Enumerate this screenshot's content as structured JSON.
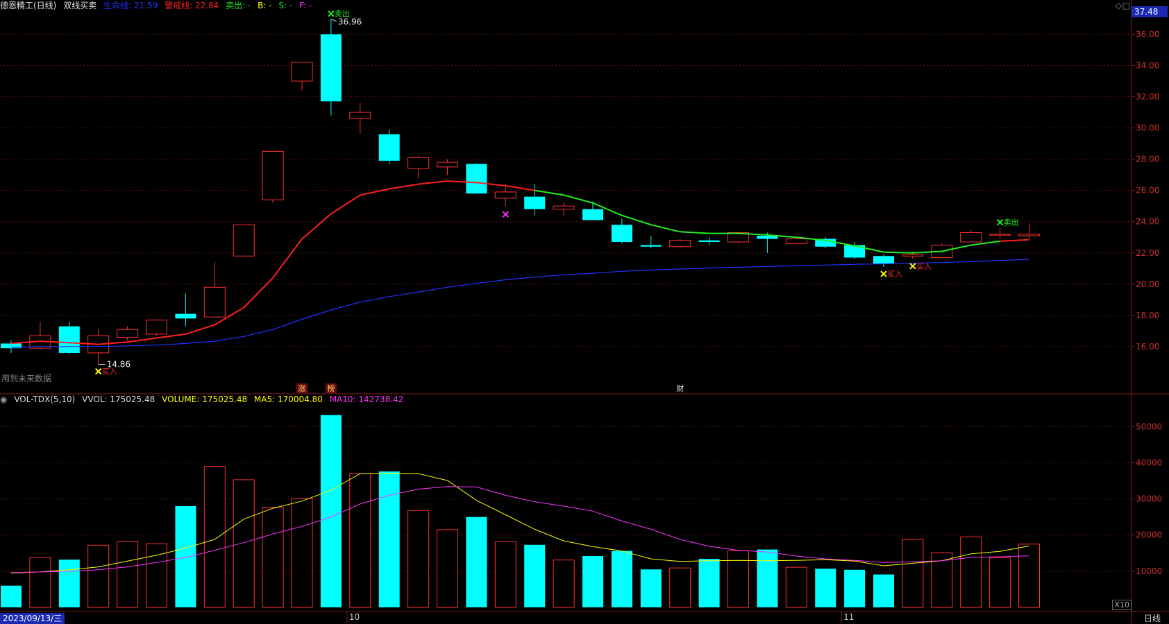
{
  "header": {
    "stock_name": "德恩精工(日线)",
    "indicator_name": "双线买卖",
    "life_line": "生命线: 21.59",
    "warn_line": "警戒线: 22.84",
    "sell": "卖出: -",
    "b": "B: -",
    "s": "S: -",
    "f": "F: -",
    "current_price_tag": "37.48",
    "colors": {
      "life": "#2233ff",
      "warn": "#ff2222",
      "sell": "#22dd22",
      "b": "#ffff00",
      "s": "#22dd22",
      "f": "#ff33ff"
    }
  },
  "volume_header": {
    "name": "VOL-TDX(5,10)",
    "vvol": "VVOL: 175025.48",
    "volume": "VOLUME: 175025.48",
    "ma5": "MA5: 170004.80",
    "ma10": "MA10: 142738.42"
  },
  "footer": {
    "date": "2023/09/13/三",
    "period": "日线",
    "future_text": "用到未来数据",
    "x10": "X10"
  },
  "icons": [
    "diamond-icon",
    "square-icon"
  ],
  "chart_data": [
    {
      "type": "candlestick",
      "y_ticks": [
        "16.00",
        "18.00",
        "20.00",
        "22.00",
        "24.00",
        "26.00",
        "28.00",
        "30.00",
        "32.00",
        "34.00",
        "36.00"
      ],
      "ylim": [
        14.0,
        37.48
      ],
      "candles": [
        {
          "o": 16.2,
          "h": 16.4,
          "l": 15.6,
          "c": 15.9
        },
        {
          "o": 15.9,
          "h": 17.6,
          "l": 15.8,
          "c": 16.7
        },
        {
          "o": 17.3,
          "h": 17.6,
          "l": 15.5,
          "c": 15.6
        },
        {
          "o": 15.6,
          "h": 17.1,
          "l": 14.86,
          "c": 16.7
        },
        {
          "o": 16.6,
          "h": 17.3,
          "l": 16.4,
          "c": 17.1
        },
        {
          "o": 16.8,
          "h": 17.7,
          "l": 16.7,
          "c": 17.7
        },
        {
          "o": 18.1,
          "h": 19.4,
          "l": 17.3,
          "c": 17.8
        },
        {
          "o": 17.9,
          "h": 21.4,
          "l": 17.9,
          "c": 19.8
        },
        {
          "o": 21.8,
          "h": 23.8,
          "l": 21.8,
          "c": 23.8
        },
        {
          "o": 25.4,
          "h": 28.5,
          "l": 25.2,
          "c": 28.5
        },
        {
          "o": 33.0,
          "h": 34.2,
          "l": 32.4,
          "c": 34.2
        },
        {
          "o": 36.0,
          "h": 36.96,
          "l": 30.8,
          "c": 31.7
        },
        {
          "o": 30.6,
          "h": 31.6,
          "l": 29.6,
          "c": 31.0
        },
        {
          "o": 29.6,
          "h": 29.9,
          "l": 27.7,
          "c": 27.9
        },
        {
          "o": 27.4,
          "h": 28.2,
          "l": 26.8,
          "c": 28.1
        },
        {
          "o": 27.5,
          "h": 28.0,
          "l": 27.0,
          "c": 27.8
        },
        {
          "o": 27.7,
          "h": 27.7,
          "l": 25.8,
          "c": 25.8
        },
        {
          "o": 25.5,
          "h": 26.4,
          "l": 25.0,
          "c": 25.9
        },
        {
          "o": 25.6,
          "h": 26.4,
          "l": 24.4,
          "c": 24.8
        },
        {
          "o": 24.8,
          "h": 25.2,
          "l": 24.4,
          "c": 25.0
        },
        {
          "o": 24.8,
          "h": 25.3,
          "l": 24.1,
          "c": 24.1
        },
        {
          "o": 23.8,
          "h": 24.2,
          "l": 22.6,
          "c": 22.7
        },
        {
          "o": 22.5,
          "h": 23.1,
          "l": 22.3,
          "c": 22.4
        },
        {
          "o": 22.4,
          "h": 22.9,
          "l": 22.3,
          "c": 22.8
        },
        {
          "o": 22.8,
          "h": 23.0,
          "l": 22.5,
          "c": 22.7
        },
        {
          "o": 22.7,
          "h": 23.3,
          "l": 22.6,
          "c": 23.3
        },
        {
          "o": 23.1,
          "h": 23.3,
          "l": 22.0,
          "c": 22.9
        },
        {
          "o": 22.6,
          "h": 23.0,
          "l": 22.6,
          "c": 22.9
        },
        {
          "o": 22.9,
          "h": 23.0,
          "l": 22.3,
          "c": 22.4
        },
        {
          "o": 22.5,
          "h": 22.7,
          "l": 21.6,
          "c": 21.7
        },
        {
          "o": 21.8,
          "h": 21.9,
          "l": 21.1,
          "c": 21.3
        },
        {
          "o": 21.8,
          "h": 22.1,
          "l": 21.6,
          "c": 21.9
        },
        {
          "o": 21.7,
          "h": 22.6,
          "l": 21.7,
          "c": 22.5
        },
        {
          "o": 22.7,
          "h": 23.5,
          "l": 22.7,
          "c": 23.3
        },
        {
          "o": 23.2,
          "h": 23.6,
          "l": 22.9,
          "c": 23.2
        },
        {
          "o": 23.1,
          "h": 23.9,
          "l": 22.9,
          "c": 23.2
        }
      ],
      "warn_line": [
        16.2,
        16.35,
        16.25,
        16.15,
        16.3,
        16.55,
        16.8,
        17.4,
        18.5,
        20.4,
        22.9,
        24.5,
        25.7,
        26.1,
        26.4,
        26.6,
        26.5,
        26.3,
        26.0,
        25.7,
        25.2,
        24.4,
        23.8,
        23.35,
        23.25,
        23.25,
        23.15,
        23.0,
        22.8,
        22.45,
        22.05,
        22.0,
        22.1,
        22.5,
        22.75,
        22.84
      ],
      "warn_line_green_from": 18,
      "warn_line_green_to": 34,
      "life_line": [
        15.95,
        16.0,
        16.0,
        16.0,
        16.05,
        16.1,
        16.2,
        16.35,
        16.65,
        17.1,
        17.75,
        18.35,
        18.85,
        19.2,
        19.5,
        19.8,
        20.05,
        20.28,
        20.45,
        20.6,
        20.7,
        20.82,
        20.9,
        20.97,
        21.03,
        21.08,
        21.13,
        21.18,
        21.22,
        21.27,
        21.3,
        21.34,
        21.38,
        21.44,
        21.52,
        21.59
      ],
      "labels": [
        {
          "i": 3,
          "text": "14.86"
        },
        {
          "i": 11,
          "text": "36.96"
        }
      ],
      "signals": [
        {
          "i": 3,
          "kind": "buy",
          "text": "买入"
        },
        {
          "i": 11,
          "kind": "sell",
          "text": "卖出"
        },
        {
          "i": 17,
          "kind": "magenta",
          "text": ""
        },
        {
          "i": 30,
          "kind": "buy",
          "text": "买入"
        },
        {
          "i": 31,
          "kind": "buy",
          "text": "买入"
        },
        {
          "i": 34,
          "kind": "sell",
          "text": "卖出"
        }
      ],
      "events": [
        {
          "i": 10,
          "text": "涨"
        },
        {
          "i": 11,
          "text": "榜"
        },
        {
          "i": 23,
          "text": "财"
        }
      ]
    },
    {
      "type": "bar",
      "y_ticks": [
        "10000",
        "20000",
        "30000",
        "40000",
        "50000"
      ],
      "ylim": [
        0,
        56000
      ],
      "volumes": [
        6000,
        13800,
        13200,
        17200,
        18200,
        17600,
        28000,
        39000,
        35300,
        27700,
        30100,
        53200,
        37000,
        37600,
        26800,
        21500,
        25000,
        18200,
        17300,
        13100,
        14200,
        15600,
        10500,
        10900,
        13400,
        15700,
        16000,
        11100,
        10700,
        10400,
        9100,
        18800,
        15100,
        19500,
        13700,
        17500
      ],
      "ma5": [
        9500,
        9800,
        10400,
        11200,
        12800,
        14400,
        16400,
        18800,
        24400,
        27400,
        29400,
        32400,
        37000,
        37100,
        37000,
        35100,
        29600,
        25600,
        21600,
        18400,
        16800,
        15600,
        13400,
        12700,
        12900,
        13000,
        12900,
        13000,
        13200,
        12800,
        11500,
        12200,
        12900,
        14800,
        15500,
        17000
      ],
      "ma10": [
        9600,
        9800,
        10000,
        10400,
        11200,
        12400,
        13800,
        15800,
        17900,
        20300,
        22400,
        25000,
        28600,
        31000,
        32700,
        33400,
        33300,
        31000,
        29200,
        28000,
        26600,
        23900,
        21600,
        18800,
        16900,
        15800,
        15300,
        14200,
        13400,
        13000,
        12400,
        12600,
        12900,
        13800,
        14000,
        14274
      ],
      "month_labels": [
        {
          "i": 12,
          "text": "10"
        },
        {
          "i": 29,
          "text": "11"
        }
      ]
    }
  ]
}
